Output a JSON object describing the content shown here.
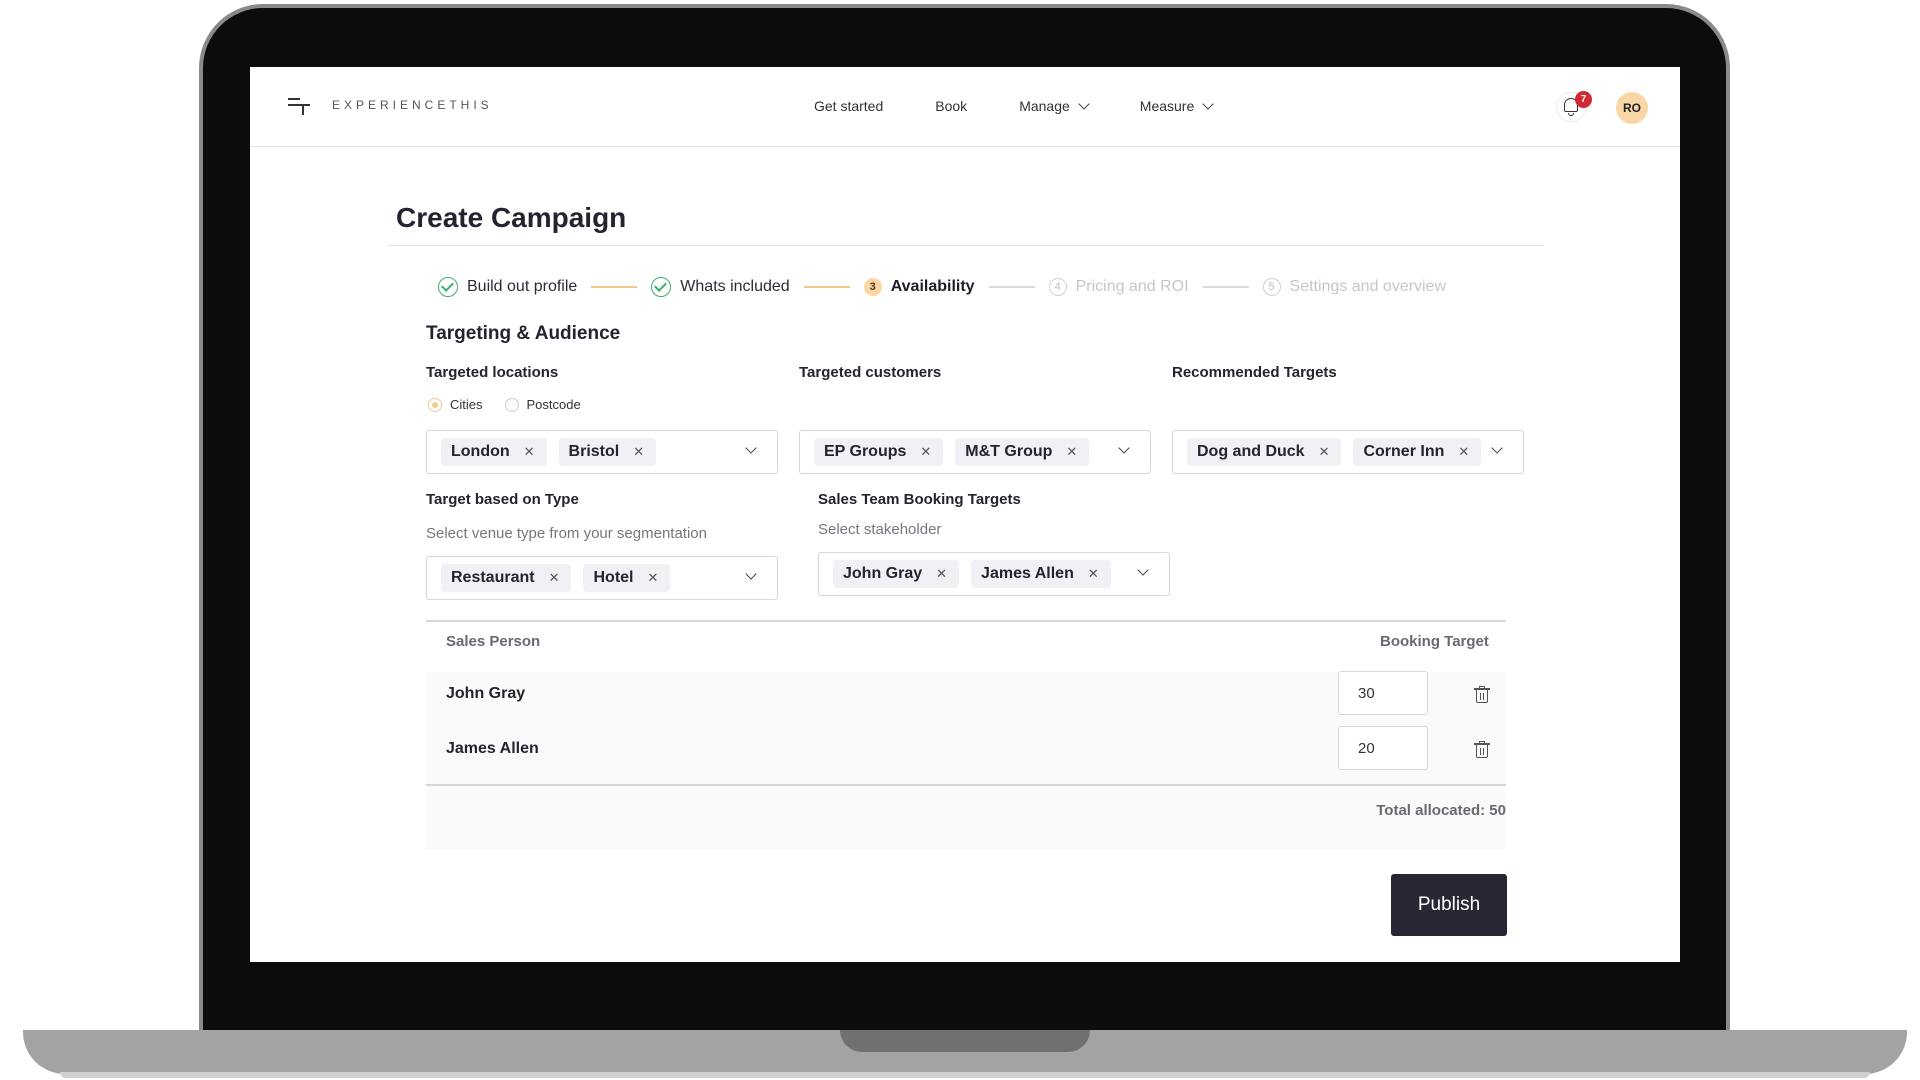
{
  "header": {
    "logo_text": "EXPERIENCETHIS",
    "nav": [
      {
        "label": "Get started"
      },
      {
        "label": "Book"
      },
      {
        "label": "Manage"
      },
      {
        "label": "Measure"
      }
    ],
    "notification_count": "7",
    "avatar_initials": "RO"
  },
  "page": {
    "title": "Create Campaign"
  },
  "stepper": {
    "steps": [
      {
        "number": "",
        "label": "Build out profile",
        "state": "done"
      },
      {
        "number": "",
        "label": "Whats included",
        "state": "done"
      },
      {
        "number": "3",
        "label": "Availability",
        "state": "active"
      },
      {
        "number": "4",
        "label": "Pricing and ROI",
        "state": "pending"
      },
      {
        "number": "5",
        "label": "Settings and overview",
        "state": "pending"
      }
    ]
  },
  "targeting": {
    "section_title": "Targeting & Audience",
    "locations": {
      "label": "Targeted locations",
      "radio_options": [
        "Cities",
        "Postcode"
      ],
      "selected_radio": "Cities",
      "chips": [
        "London",
        "Bristol"
      ]
    },
    "customers": {
      "label": "Targeted customers",
      "chips": [
        "EP Groups",
        "M&T Group"
      ]
    },
    "recommended": {
      "label": "Recommended Targets",
      "chips": [
        "Dog and Duck",
        "Corner Inn"
      ]
    },
    "type": {
      "label": "Target based on Type",
      "sub": "Select venue type from your segmentation",
      "chips": [
        "Restaurant",
        "Hotel"
      ]
    },
    "sales_team": {
      "label": "Sales Team Booking Targets",
      "sub": "Select stakeholder",
      "chips": [
        "John Gray",
        "James Allen"
      ]
    }
  },
  "table": {
    "col_person": "Sales Person",
    "col_target": "Booking Target",
    "rows": [
      {
        "name": "John Gray",
        "target": "30"
      },
      {
        "name": "James Allen",
        "target": "20"
      }
    ],
    "total": "Total allocated: 50"
  },
  "actions": {
    "publish_label": "Publish"
  },
  "colors": {
    "accent": "#f3c98c",
    "success": "#3cae6c",
    "primary_button": "#2a2535",
    "badge": "#d22a33"
  }
}
